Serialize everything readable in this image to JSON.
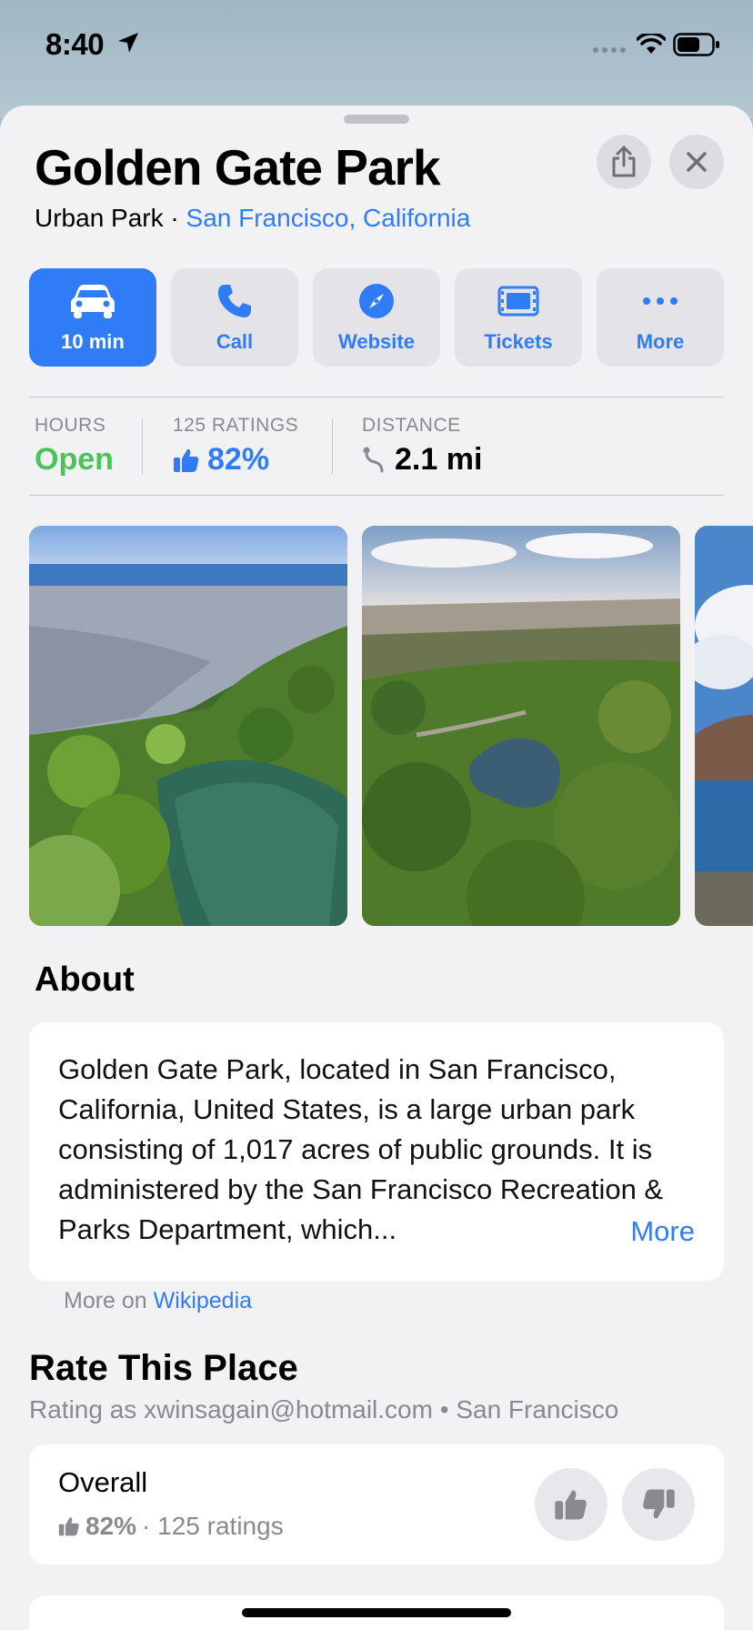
{
  "status_bar": {
    "time": "8:40"
  },
  "place": {
    "title": "Golden Gate Park",
    "category": "Urban Park",
    "separator": "·",
    "location": "San Francisco, California"
  },
  "actions": [
    {
      "label": "10 min",
      "icon": "car-icon"
    },
    {
      "label": "Call",
      "icon": "phone-icon"
    },
    {
      "label": "Website",
      "icon": "compass-icon"
    },
    {
      "label": "Tickets",
      "icon": "ticket-icon"
    },
    {
      "label": "More",
      "icon": "ellipsis-icon"
    }
  ],
  "stats": {
    "hours_caption": "HOURS",
    "hours_value": "Open",
    "ratings_caption": "125 RATINGS",
    "ratings_value": "82%",
    "distance_caption": "DISTANCE",
    "distance_value": "2.1 mi"
  },
  "photos": [
    {
      "description": "aerial-park-lake-city-ocean"
    },
    {
      "description": "aerial-park-pond-forest"
    },
    {
      "description": "bridge-ocean-clouds"
    }
  ],
  "about": {
    "heading": "About",
    "text": "Golden Gate Park, located in San Francisco, California, United States, is a large urban park consisting of 1,017 acres of public grounds. It is administered by the San Francisco Recreation & Parks Department, which...",
    "more_label": "More",
    "source_prefix": "More on",
    "source_link": "Wikipedia"
  },
  "rate": {
    "heading": "Rate This Place",
    "subtitle": "Rating as xwinsagain@hotmail.com • San Francisco",
    "overall_label": "Overall",
    "overall_percent": "82%",
    "overall_count": "· 125 ratings"
  },
  "colors": {
    "accent": "#2f7cf6",
    "open_green": "#4cc25a",
    "sheet_bg": "#f2f2f4"
  }
}
